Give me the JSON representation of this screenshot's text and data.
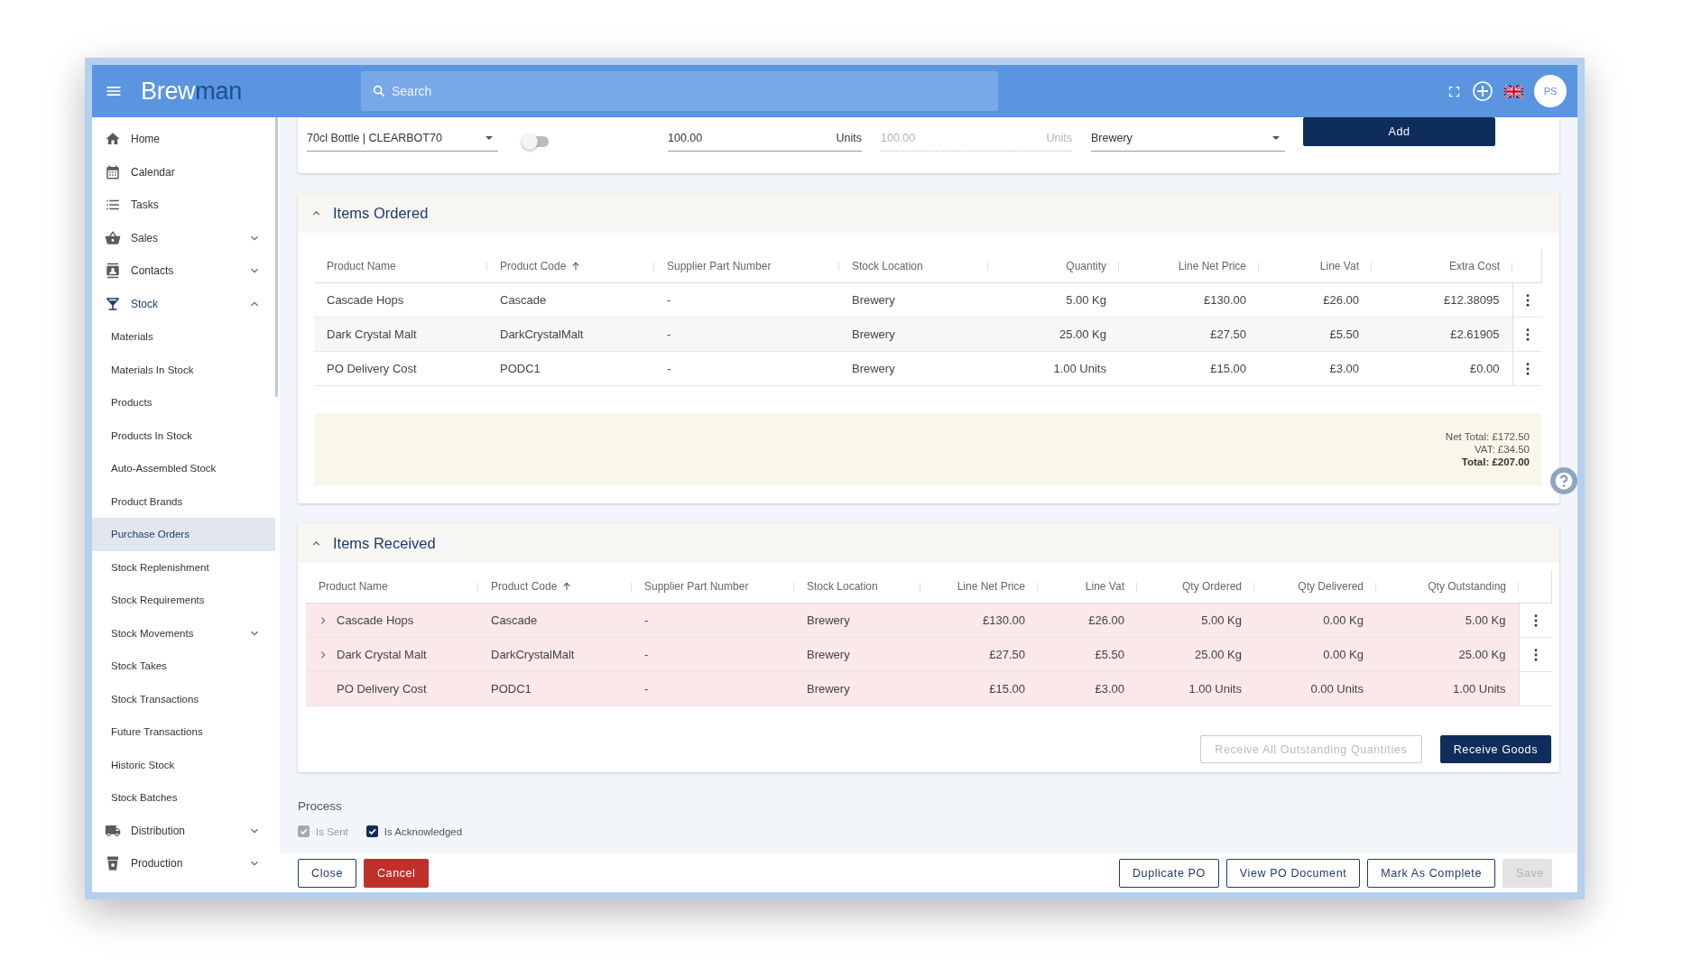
{
  "topbar": {
    "logo": [
      "Brew",
      "man"
    ],
    "search": {
      "placeholder": "Search"
    },
    "avatar": "PS"
  },
  "sidebar": {
    "items": [
      {
        "label": "Home",
        "kind": "home",
        "selected": false
      },
      {
        "label": "Calendar",
        "kind": "calendar",
        "selected": false
      },
      {
        "label": "Tasks",
        "kind": "tasks",
        "selected": false
      },
      {
        "label": "Sales",
        "kind": "sales",
        "selected": false,
        "expanded": false
      },
      {
        "label": "Contacts",
        "kind": "contacts",
        "selected": false,
        "expanded": false
      },
      {
        "label": "Stock",
        "kind": "stock",
        "selected": false,
        "expanded": true,
        "children": [
          {
            "label": "Materials",
            "selected": false
          },
          {
            "label": "Materials In Stock",
            "selected": false
          },
          {
            "label": "Products",
            "selected": false
          },
          {
            "label": "Products In Stock",
            "selected": false
          },
          {
            "label": "Auto-Assembled Stock",
            "selected": false
          },
          {
            "label": "Product Brands",
            "selected": false
          },
          {
            "label": "Purchase Orders",
            "selected": true
          },
          {
            "label": "Stock Replenishment",
            "selected": false
          },
          {
            "label": "Stock Requirements",
            "selected": false
          },
          {
            "label": "Stock Movements",
            "selected": false,
            "expanded": false
          },
          {
            "label": "Stock Takes",
            "selected": false
          },
          {
            "label": "Stock Transactions",
            "selected": false
          },
          {
            "label": "Future Transactions",
            "selected": false
          },
          {
            "label": "Historic Stock",
            "selected": false
          },
          {
            "label": "Stock Batches",
            "selected": false
          }
        ]
      },
      {
        "label": "Distribution",
        "kind": "distribution",
        "selected": false,
        "expanded": false
      },
      {
        "label": "Production",
        "kind": "production",
        "selected": false,
        "expanded": false
      }
    ]
  },
  "entry_form": {
    "product": {
      "value": "70cl Bottle | CLEARBOT70"
    },
    "toggle": {
      "on": false
    },
    "quantity": {
      "value": "100.00",
      "unit": "Units",
      "disabled": false
    },
    "quantity_2": {
      "value": "100.00",
      "unit": "Units",
      "disabled": true
    },
    "location": {
      "value": "Brewery"
    },
    "add_button": "Add"
  },
  "items_ordered": {
    "title": "Items Ordered",
    "expanded": true,
    "columns": [
      {
        "label": "Product Name",
        "kind": "text",
        "sorted": false
      },
      {
        "label": "Product Code",
        "kind": "text",
        "sorted": true
      },
      {
        "label": "Supplier Part Number",
        "kind": "text",
        "sorted": false
      },
      {
        "label": "Stock Location",
        "kind": "text",
        "sorted": false
      },
      {
        "label": "Quantity",
        "kind": "number",
        "sorted": false
      },
      {
        "label": "Line Net Price",
        "kind": "number",
        "sorted": false
      },
      {
        "label": "Line Vat",
        "kind": "number",
        "sorted": false
      },
      {
        "label": "Extra Cost",
        "kind": "number",
        "sorted": false
      }
    ],
    "rows": [
      {
        "cells": [
          "Cascade Hops",
          "Cascade",
          "-",
          "Brewery",
          "5.00 Kg",
          "£130.00",
          "£26.00",
          "£12.38095"
        ]
      },
      {
        "cells": [
          "Dark Crystal Malt",
          "DarkCrystalMalt",
          "-",
          "Brewery",
          "25.00 Kg",
          "£27.50",
          "£5.50",
          "£2.61905"
        ]
      },
      {
        "cells": [
          "PO Delivery Cost",
          "PODC1",
          "-",
          "Brewery",
          "1.00 Units",
          "£15.00",
          "£3.00",
          "£0.00"
        ]
      }
    ],
    "totals": [
      {
        "text": "Net Total: £172.50",
        "kind": "subtotal"
      },
      {
        "text": "VAT: £34.50",
        "kind": "subtotal"
      },
      {
        "text": "Total: £207.00",
        "kind": "grand_total"
      }
    ]
  },
  "items_received": {
    "title": "Items Received",
    "expanded": true,
    "columns": [
      {
        "label": "Product Name",
        "kind": "text",
        "sorted": false
      },
      {
        "label": "Product Code",
        "kind": "text",
        "sorted": true
      },
      {
        "label": "Supplier Part Number",
        "kind": "text",
        "sorted": false
      },
      {
        "label": "Stock Location",
        "kind": "text",
        "sorted": false
      },
      {
        "label": "Line Net Price",
        "kind": "number",
        "sorted": false
      },
      {
        "label": "Line Vat",
        "kind": "number",
        "sorted": false
      },
      {
        "label": "Qty Ordered",
        "kind": "number",
        "sorted": false
      },
      {
        "label": "Qty Delivered",
        "kind": "number",
        "sorted": false
      },
      {
        "label": "Qty Outstanding",
        "kind": "number",
        "sorted": false
      }
    ],
    "rows": [
      {
        "cells": [
          "Cascade Hops",
          "Cascade",
          "-",
          "Brewery",
          "£130.00",
          "£26.00",
          "5.00 Kg",
          "0.00 Kg",
          "5.00 Kg"
        ],
        "kind": "expandable",
        "expanded": false
      },
      {
        "cells": [
          "Dark Crystal Malt",
          "DarkCrystalMalt",
          "-",
          "Brewery",
          "£27.50",
          "£5.50",
          "25.00 Kg",
          "0.00 Kg",
          "25.00 Kg"
        ],
        "kind": "expandable",
        "expanded": false
      },
      {
        "cells": [
          "PO Delivery Cost",
          "PODC1",
          "-",
          "Brewery",
          "£15.00",
          "£3.00",
          "1.00 Units",
          "0.00 Units",
          "1.00 Units"
        ],
        "kind": "plain"
      }
    ],
    "buttons": [
      {
        "label": "Receive All Outstanding Quantities",
        "kind": "secondary",
        "disabled": true
      },
      {
        "label": "Receive Goods",
        "kind": "primary",
        "disabled": false
      }
    ]
  },
  "process": {
    "title": "Process",
    "checkboxes": [
      {
        "label": "Is Sent",
        "checked": true,
        "disabled": true
      },
      {
        "label": "Is Acknowledged",
        "checked": true,
        "disabled": false
      }
    ]
  },
  "footer": {
    "left": [
      {
        "label": "Close",
        "kind": "secondary",
        "disabled": false
      },
      {
        "label": "Cancel",
        "kind": "danger",
        "disabled": false
      }
    ],
    "right": [
      {
        "label": "Duplicate PO",
        "kind": "secondary",
        "disabled": false
      },
      {
        "label": "View PO Document",
        "kind": "secondary",
        "disabled": false
      },
      {
        "label": "Mark As Complete",
        "kind": "secondary",
        "disabled": false
      },
      {
        "label": "Save",
        "kind": "primary",
        "disabled": true
      }
    ]
  }
}
